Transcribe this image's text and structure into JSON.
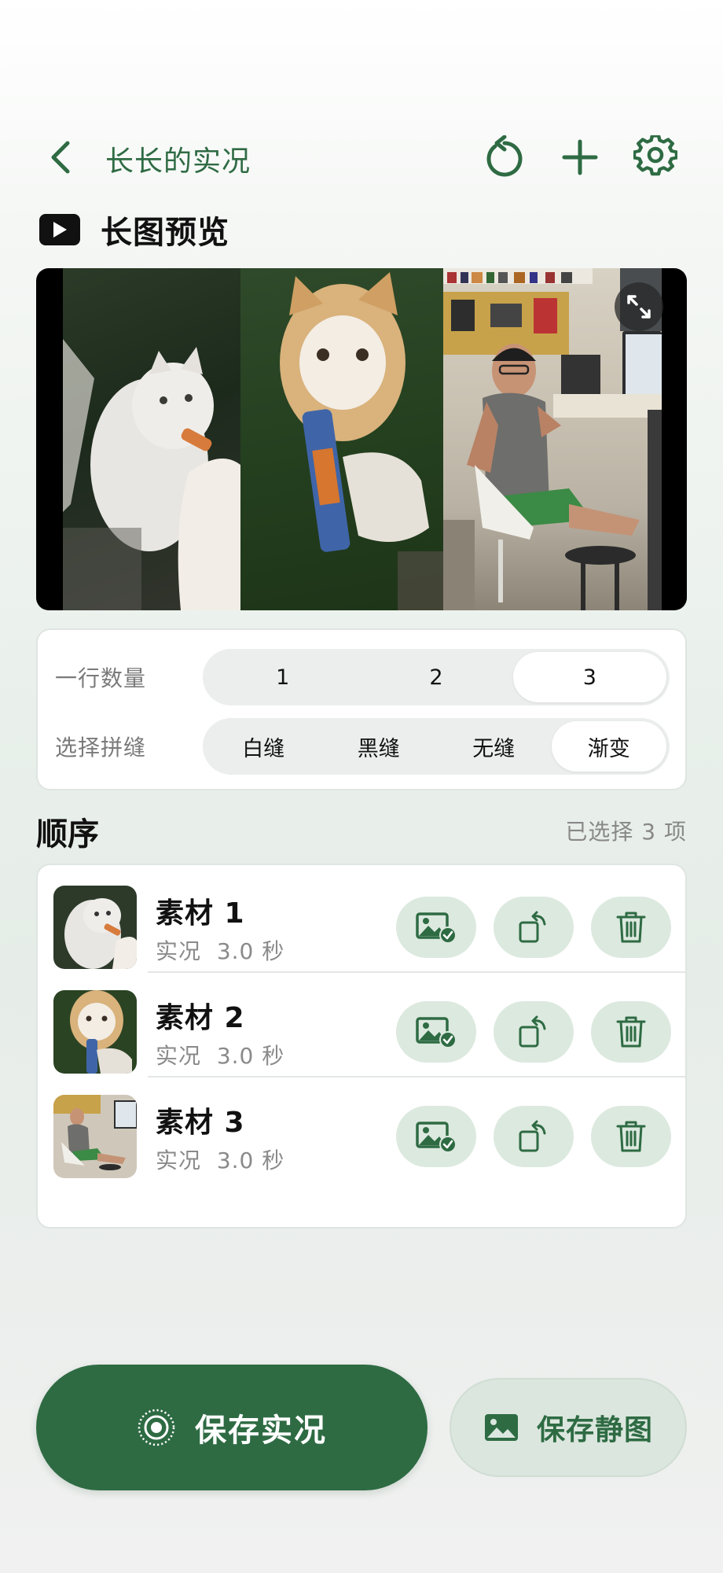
{
  "header": {
    "title": "长长的实况",
    "icons": [
      "back-chevron-icon",
      "refresh-icon",
      "plus-icon",
      "gear-icon"
    ]
  },
  "preview_section": {
    "title": "长图预览",
    "icon": "play-icon",
    "expand_icon": "expand-arrows-icon"
  },
  "options": {
    "per_row": {
      "label": "一行数量",
      "choices": [
        "1",
        "2",
        "3"
      ],
      "selected": "3"
    },
    "seam": {
      "label": "选择拼缝",
      "choices": [
        "白缝",
        "黑缝",
        "无缝",
        "渐变"
      ],
      "selected": "渐变"
    }
  },
  "order": {
    "title": "顺序",
    "selected_count": "已选择 3 项",
    "items": [
      {
        "name": "素材 1",
        "type": "实况",
        "duration": "3.0 秒"
      },
      {
        "name": "素材 2",
        "type": "实况",
        "duration": "3.0 秒"
      },
      {
        "name": "素材 3",
        "type": "实况",
        "duration": "3.0 秒"
      }
    ],
    "item_action_icons": [
      "image-check-icon",
      "rotate-icon",
      "trash-icon"
    ]
  },
  "actions": {
    "save_live": "保存实况",
    "save_still": "保存静图"
  },
  "colors": {
    "accent": "#2e6b43",
    "accent_light": "#dce9df",
    "background": "#e9f0eb"
  }
}
